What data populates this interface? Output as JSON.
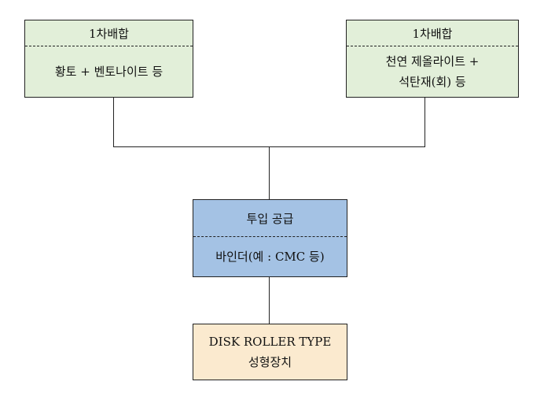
{
  "nodes": {
    "left": {
      "title": "1차배합",
      "body": [
        "황토 + 벤토나이트 등"
      ]
    },
    "right": {
      "title": "1차배합",
      "body": [
        "천연 제올라이트 +",
        "석탄재(회) 등"
      ]
    },
    "supply": {
      "title": "투입 공급",
      "body": [
        "바인더(예 : CMC 등)"
      ]
    },
    "device": {
      "body": [
        "DISK ROLLER TYPE",
        "성형장치"
      ]
    }
  },
  "colors": {
    "mix": "#e2efd9",
    "supply": "#a4c2e4",
    "device": "#fbeacf"
  }
}
